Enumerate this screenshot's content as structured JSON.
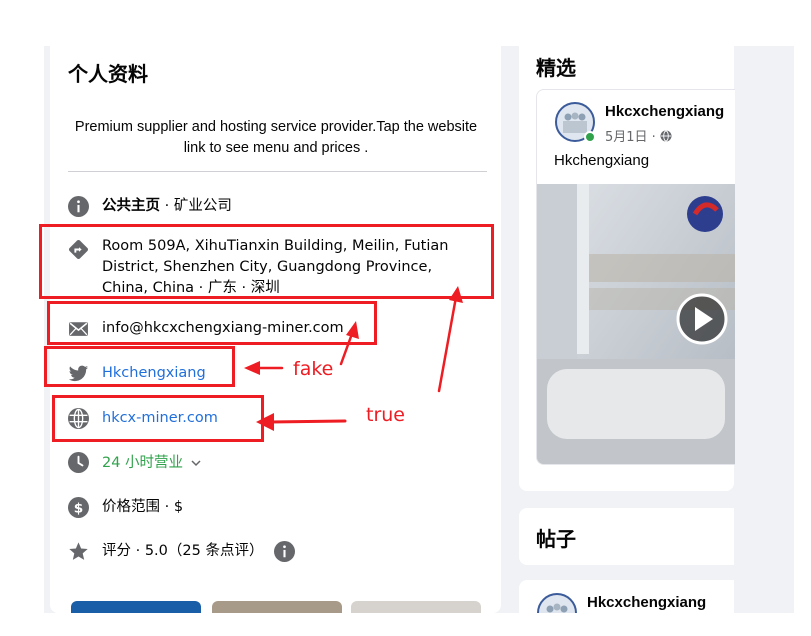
{
  "about": {
    "title": "个人资料",
    "bio": "Premium supplier and hosting service provider.Tap the website link to see menu and prices .",
    "category_bold": "公共主页",
    "category_rest": " · 矿业公司",
    "address": "Room 509A, XihuTianxin Building, Meilin, Futian District, Shenzhen City, Guangdong Province, China, China · 广东 · 深圳",
    "email": "info@hkcxchengxiang-miner.com",
    "twitter": "Hkchengxiang",
    "website": "hkcx-miner.com",
    "hours": "24 小时营业",
    "price": "价格范围 · $",
    "rating": "评分 · 5.0（25 条点评）"
  },
  "annotations": {
    "fake_label": "fake",
    "true_label": "true",
    "color": "#ee1d23"
  },
  "featured": {
    "title": "精选",
    "post": {
      "author": "Hkcxchengxiang",
      "date": "5月1日 · ",
      "text": "Hkchengxiang"
    }
  },
  "posts": {
    "title": "帖子",
    "author": "Hkcxchengxiang"
  },
  "colors": {
    "link": "#216fdb",
    "open_green": "#31a24c",
    "icon_gray": "#65676b",
    "background": "#f0f2f5"
  }
}
